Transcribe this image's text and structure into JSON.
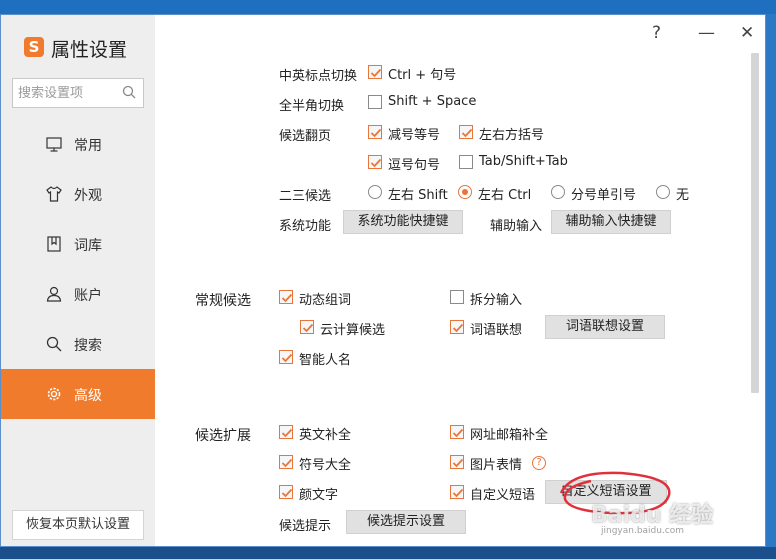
{
  "app": {
    "title": "属性设置",
    "logo_letter": "S",
    "accent": "#f07b2d"
  },
  "search": {
    "placeholder": "搜索设置项"
  },
  "window_controls": {
    "help": "?",
    "minimize": "—",
    "close": "✕"
  },
  "sidebar": {
    "items": [
      {
        "label": "常用",
        "icon": "monitor-icon"
      },
      {
        "label": "外观",
        "icon": "shirt-icon"
      },
      {
        "label": "词库",
        "icon": "book-icon"
      },
      {
        "label": "账户",
        "icon": "user-icon"
      },
      {
        "label": "搜索",
        "icon": "search-icon"
      },
      {
        "label": "高级",
        "icon": "gear-icon",
        "active": true
      }
    ],
    "reset_label": "恢复本页默认设置"
  },
  "shortcuts": {
    "punct_label": "中英标点切换",
    "punct_option": "Ctrl + 句号",
    "width_label": "全半角切换",
    "width_option": "Shift + Space",
    "page_label": "候选翻页",
    "page_opt1": "减号等号",
    "page_opt2": "左右方括号",
    "page_opt3": "逗号句号",
    "page_opt4": "Tab/Shift+Tab",
    "second_label": "二三候选",
    "second_opt1": "左右 Shift",
    "second_opt2": "左右 Ctrl",
    "second_opt3": "分号单引号",
    "second_opt4": "无",
    "sys_label": "系统功能",
    "sys_button": "系统功能快捷键",
    "aux_label": "辅助输入",
    "aux_button": "辅助输入快捷键"
  },
  "regular": {
    "title": "常规候选",
    "dynamic": "动态组词",
    "split": "拆分输入",
    "cloud": "云计算候选",
    "assoc": "词语联想",
    "assoc_button": "词语联想设置",
    "names": "智能人名"
  },
  "extension": {
    "title": "候选扩展",
    "english": "英文补全",
    "url": "网址邮箱补全",
    "symbols": "符号大全",
    "emoji": "图片表情",
    "kaomoji": "颜文字",
    "custom": "自定义短语",
    "custom_button": "自定义短语设置",
    "hint_label": "候选提示",
    "hint_button": "候选提示设置"
  },
  "watermark": {
    "main": "Baidu 经验",
    "sub": "jingyan.baidu.com"
  }
}
